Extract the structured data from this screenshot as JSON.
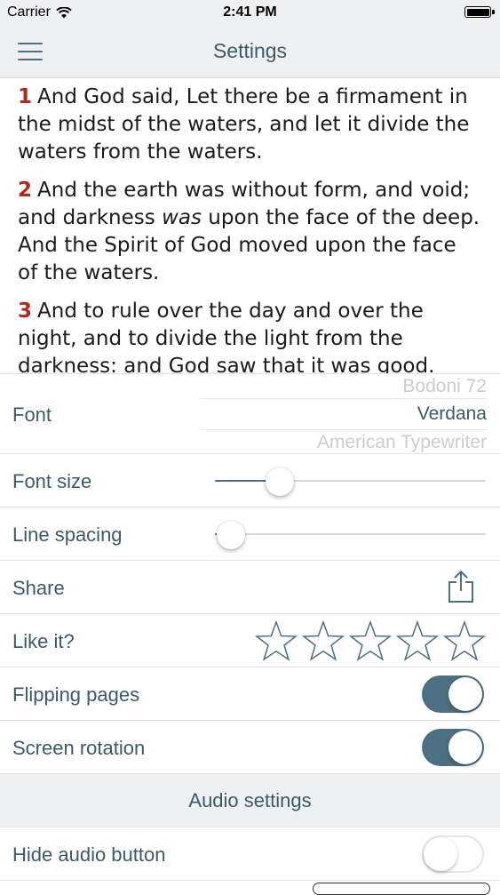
{
  "status_bar": {
    "carrier": "Carrier",
    "time": "2:41 PM"
  },
  "nav": {
    "title": "Settings"
  },
  "reading": {
    "verses": [
      {
        "num": "1",
        "text": "And God said, Let there be a firmament in the midst of the waters, and let it divide the waters from the waters."
      },
      {
        "num": "2",
        "text_before": "And the earth was without form, and void; and darkness ",
        "text_italic": "was",
        "text_after": " upon the face of the deep. And the Spirit of God moved upon the face of the waters."
      },
      {
        "num": "3",
        "text": "And to rule over the day and over the night, and to divide the light from the darkness: and God saw that it was good."
      }
    ]
  },
  "settings": {
    "font": {
      "label": "Font",
      "options": [
        "Bodoni 72",
        "Verdana",
        "American Typewriter"
      ],
      "selected": "Verdana"
    },
    "font_size": {
      "label": "Font size",
      "value": 0.24
    },
    "line_spacing": {
      "label": "Line spacing",
      "value": 0.06
    },
    "share": {
      "label": "Share"
    },
    "like": {
      "label": "Like it?",
      "rating": 0,
      "max": 5
    },
    "flipping_pages": {
      "label": "Flipping pages",
      "on": true
    },
    "screen_rotation": {
      "label": "Screen rotation",
      "on": true
    },
    "audio_header": "Audio settings",
    "hide_audio": {
      "label": "Hide audio button",
      "on": false
    }
  },
  "colors": {
    "accent": "#4d6f82",
    "verse_number": "#b02a1e",
    "text": "#3c5a6a",
    "bar_bg": "#eef0f2"
  }
}
